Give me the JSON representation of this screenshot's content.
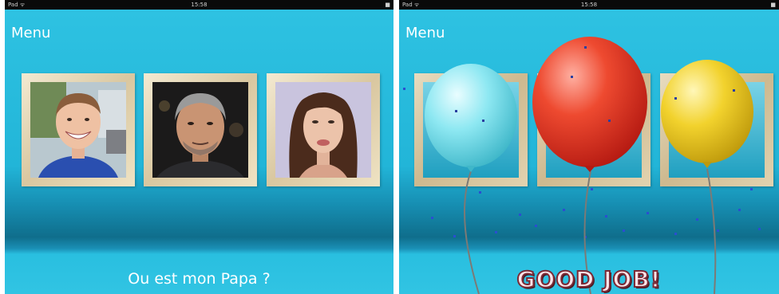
{
  "status_bar": {
    "carrier": "Pad ᯤ",
    "time": "15:58",
    "battery": "■"
  },
  "menu": {
    "label": "Menu"
  },
  "game": {
    "question": "Ou est mon Papa ?",
    "success_message": "GOOD JOB!",
    "candidates": [
      {
        "name": "photo-young-man"
      },
      {
        "name": "photo-gray-haired-man"
      },
      {
        "name": "photo-woman"
      }
    ]
  },
  "colors": {
    "background": "#2ec2e2",
    "frame": "#d9c7a0",
    "balloon_cyan": "#7fe3ef",
    "balloon_red": "#e0341f",
    "balloon_yellow": "#ebc91e",
    "good_job_outline": "#7a2a36"
  }
}
